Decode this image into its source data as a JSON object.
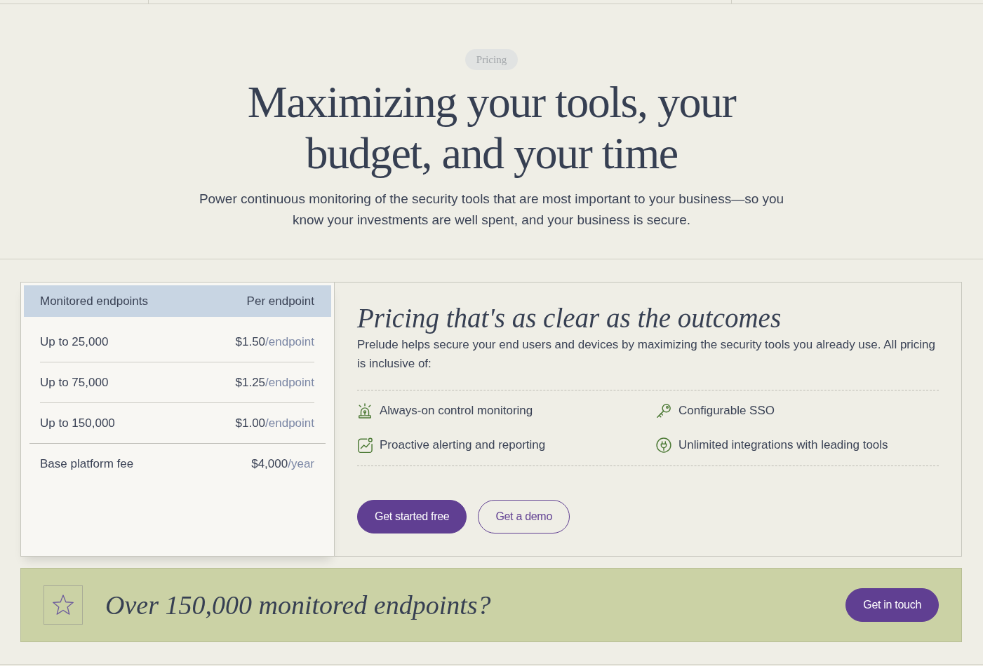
{
  "hero": {
    "tag": "Pricing",
    "headline": "Maximizing your tools, your budget, and your time",
    "intro": "Power continuous monitoring of the security tools that are most important to your business—so you know your investments are well spent, and your business is secure."
  },
  "price_table": {
    "columns": [
      "Monitored endpoints",
      "Per endpoint"
    ],
    "tiers": [
      {
        "range": "Up to 25,000",
        "price": "$1.50",
        "unit": "/endpoint"
      },
      {
        "range": "Up to 75,000",
        "price": "$1.25",
        "unit": "/endpoint"
      },
      {
        "range": "Up to 150,000",
        "price": "$1.00",
        "unit": "/endpoint"
      }
    ],
    "base_fee": {
      "label": "Base platform fee",
      "price": "$4,000",
      "unit": "/year"
    }
  },
  "details": {
    "title": "Pricing that's as clear as the outcomes",
    "description": "Prelude helps secure your end users and devices by maximizing the security tools you already use. All pricing is inclusive of:",
    "features": [
      {
        "label": "Always-on control monitoring"
      },
      {
        "label": "Configurable SSO"
      },
      {
        "label": "Proactive alerting and reporting"
      },
      {
        "label": "Unlimited integrations with leading tools"
      }
    ],
    "buttons": [
      {
        "label": "Get started free",
        "kind": "primary"
      },
      {
        "label": "Get a demo",
        "kind": "secondary"
      }
    ]
  },
  "banner": {
    "title": "Over 150,000 monitored endpoints?",
    "button": "Get in touch"
  }
}
